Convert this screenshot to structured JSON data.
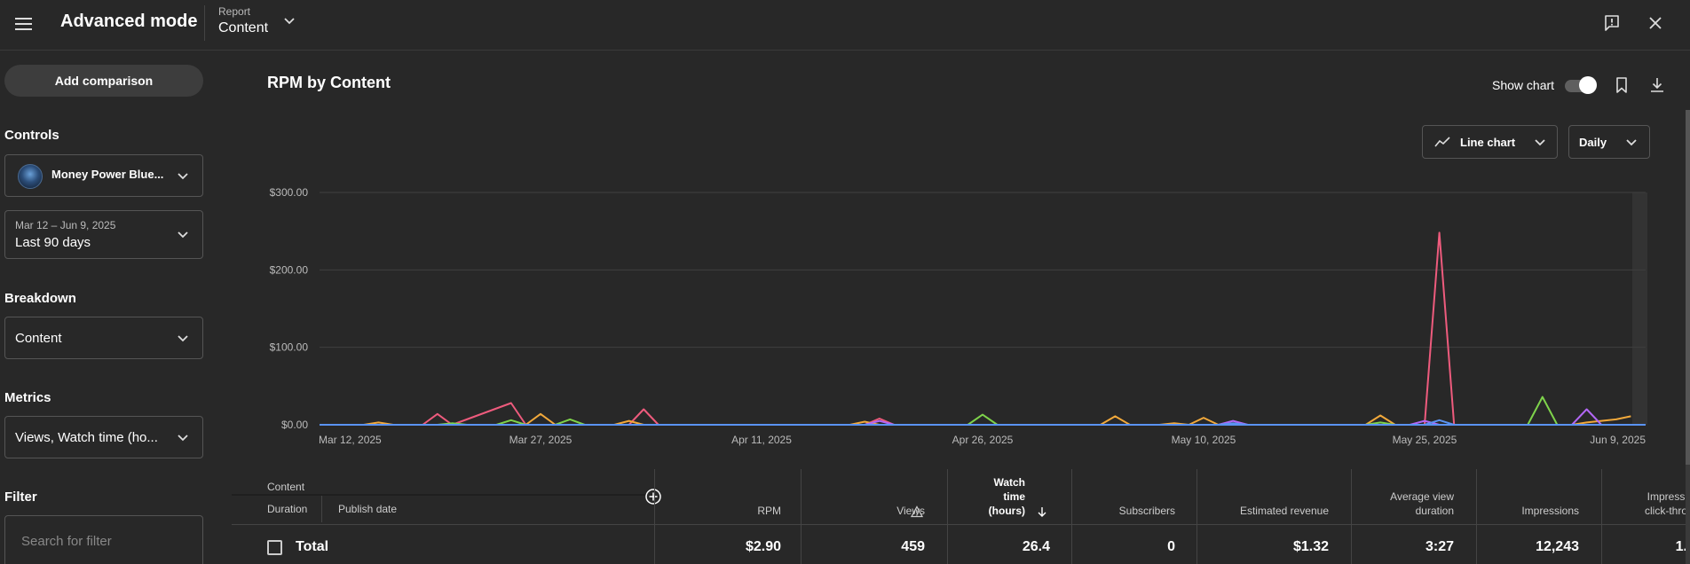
{
  "header": {
    "title": "Advanced mode",
    "report_label": "Report",
    "report_value": "Content"
  },
  "sidebar": {
    "add_comparison": "Add comparison",
    "controls_label": "Controls",
    "channel": "Money Power Blue...",
    "date_range_small": "Mar 12 – Jun 9, 2025",
    "date_range": "Last 90 days",
    "breakdown_label": "Breakdown",
    "breakdown_value": "Content",
    "metrics_label": "Metrics",
    "metrics_value": "Views, Watch time (ho...",
    "filter_label": "Filter",
    "filter_placeholder": "Search for filter"
  },
  "chart_toolbar": {
    "title": "RPM by Content",
    "show_chart": "Show chart",
    "show_chart_on": true,
    "chart_type": "Line chart",
    "granularity": "Daily"
  },
  "chart_data": {
    "type": "line",
    "title": "RPM by Content",
    "ylim": [
      0,
      300
    ],
    "y_ticks": [
      "$0.00",
      "$100.00",
      "$200.00",
      "$300.00"
    ],
    "x_ticks": [
      "Mar 12, 2025",
      "Mar 27, 2025",
      "Apr 11, 2025",
      "Apr 26, 2025",
      "May 10, 2025",
      "May 25, 2025",
      "Jun 9, 2025"
    ],
    "x_days": 90,
    "grid": true,
    "series": [
      {
        "color": "#ee5b7d",
        "points": [
          [
            7,
            0
          ],
          [
            8,
            14
          ],
          [
            9,
            0
          ],
          [
            13,
            28
          ],
          [
            14,
            0
          ],
          [
            21,
            0
          ],
          [
            22,
            20
          ],
          [
            23,
            0
          ],
          [
            37,
            0
          ],
          [
            38,
            8
          ],
          [
            39,
            0
          ],
          [
            75,
            0
          ],
          [
            76,
            248
          ],
          [
            77,
            0
          ]
        ]
      },
      {
        "color": "#f2a93b",
        "points": [
          [
            3,
            0
          ],
          [
            4,
            3
          ],
          [
            5,
            0
          ],
          [
            14,
            0
          ],
          [
            15,
            14
          ],
          [
            16,
            0
          ],
          [
            20,
            0
          ],
          [
            21,
            5
          ],
          [
            22,
            0
          ],
          [
            36,
            0
          ],
          [
            37,
            4
          ],
          [
            38,
            0
          ],
          [
            53,
            0
          ],
          [
            54,
            11
          ],
          [
            55,
            0
          ],
          [
            57,
            0
          ],
          [
            58,
            2
          ],
          [
            59,
            0
          ],
          [
            59,
            0
          ],
          [
            60,
            9
          ],
          [
            61,
            0
          ],
          [
            71,
            0
          ],
          [
            72,
            12
          ],
          [
            73,
            0
          ],
          [
            85,
            0
          ],
          [
            86,
            3
          ],
          [
            88,
            7
          ],
          [
            89,
            11
          ]
        ]
      },
      {
        "color": "#7ed34b",
        "points": [
          [
            8,
            0
          ],
          [
            9,
            2
          ],
          [
            10,
            0
          ],
          [
            12,
            0
          ],
          [
            13,
            6
          ],
          [
            14,
            0
          ],
          [
            16,
            0
          ],
          [
            17,
            7
          ],
          [
            18,
            0
          ],
          [
            44,
            0
          ],
          [
            45,
            13
          ],
          [
            46,
            0
          ],
          [
            71,
            0
          ],
          [
            72,
            3
          ],
          [
            73,
            0
          ],
          [
            82,
            0
          ],
          [
            83,
            36
          ],
          [
            84,
            0
          ]
        ]
      },
      {
        "color": "#b267f5",
        "points": [
          [
            37,
            0
          ],
          [
            38,
            5
          ],
          [
            39,
            0
          ],
          [
            61,
            0
          ],
          [
            62,
            5
          ],
          [
            63,
            0
          ],
          [
            74,
            0
          ],
          [
            75,
            5
          ],
          [
            76,
            0
          ],
          [
            85,
            0
          ],
          [
            86,
            20
          ],
          [
            87,
            0
          ]
        ]
      },
      {
        "color": "#5a93f2",
        "points": [
          [
            0,
            0
          ],
          [
            90,
            0
          ],
          [
            61,
            0
          ],
          [
            62,
            2
          ],
          [
            63,
            0
          ],
          [
            75,
            0
          ],
          [
            76,
            6
          ],
          [
            77,
            0
          ]
        ]
      }
    ]
  },
  "table": {
    "content_header": "Content",
    "duration_header": "Duration",
    "publish_header": "Publish date",
    "columns": [
      {
        "l1": "",
        "l2": "",
        "l3": "RPM"
      },
      {
        "l1": "",
        "l2": "",
        "l3": "Views"
      },
      {
        "l1": "Watch",
        "l2": "time",
        "l3": "(hours)"
      },
      {
        "l1": "",
        "l2": "",
        "l3": "Subscribers"
      },
      {
        "l1": "",
        "l2": "",
        "l3": "Estimated revenue"
      },
      {
        "l1": "",
        "l2": "Average view",
        "l3": "duration"
      },
      {
        "l1": "",
        "l2": "",
        "l3": "Impressions"
      },
      {
        "l1": "",
        "l2": "Impressi",
        "l3": "click-thro"
      }
    ],
    "total_label": "Total",
    "totals": [
      "$2.90",
      "459",
      "26.4",
      "0",
      "$1.32",
      "3:27",
      "12,243",
      "1."
    ]
  }
}
